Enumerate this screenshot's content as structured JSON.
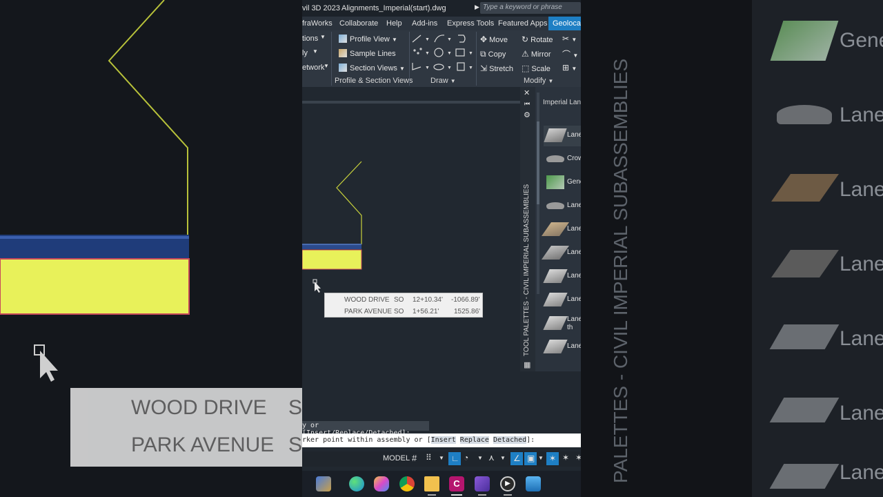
{
  "titlebar": {
    "app_name": "vil 3D 2023",
    "file_name": "Alignments_Imperial(start).dwg",
    "search_placeholder": "Type a keyword or phrase"
  },
  "tabs": [
    "fraWorks",
    "Collaborate",
    "Help",
    "Add-ins",
    "Express Tools",
    "Featured Apps",
    "Geolocat"
  ],
  "ribbon": {
    "left_items": [
      "tions",
      "ly",
      "etwork"
    ],
    "profile_section": {
      "items": [
        "Profile View",
        "Sample Lines",
        "Section Views"
      ],
      "label": "Profile & Section Views"
    },
    "draw_label": "Draw",
    "modify": {
      "items": [
        "Move",
        "Rotate",
        "Copy",
        "Mirror",
        "Stretch",
        "Scale"
      ],
      "label": "Modify"
    }
  },
  "palette": {
    "header": "Imperial Lan",
    "vertical_title": "TOOL PALETTES - CIVIL IMPERIAL SUBASSEMBLIES",
    "items": [
      "Lane",
      "Crow",
      "Gene",
      "Lane",
      "Lane",
      "Lane",
      "Lane",
      "Lane",
      "Lane th",
      "Lane"
    ]
  },
  "tooltip": {
    "rows": [
      {
        "name": "WOOD DRIVE",
        "code": "SO",
        "station": "12+10.34'",
        "offset": "-1066.89'"
      },
      {
        "name": "PARK AVENUE",
        "code": "SO",
        "station": "1+56.21'",
        "offset": "1525.86'"
      }
    ]
  },
  "command": {
    "history": "y or [Insert/Replace/Detached]:",
    "prompt": "rker point within assembly or [",
    "options": [
      "Insert",
      "Replace",
      "Detached"
    ],
    "end": "]:"
  },
  "statusbar": {
    "model": "MODEL"
  },
  "background": {
    "left_labels": [
      "WOOD DRIVE",
      "PARK AVENUE"
    ],
    "left_codes": [
      "S",
      "S"
    ],
    "right_labels": [
      "Gene",
      "Lane",
      "Lane",
      "Lane",
      "Lane",
      "Lane",
      "Lane"
    ],
    "right_vertical": "PALETTES - CIVIL IMPERIAL SUBASSEMBLIES"
  },
  "colors": {
    "accent": "#1e7fc4",
    "subassembly_fill": "#e8f15a",
    "linework": "#c8d23c"
  }
}
